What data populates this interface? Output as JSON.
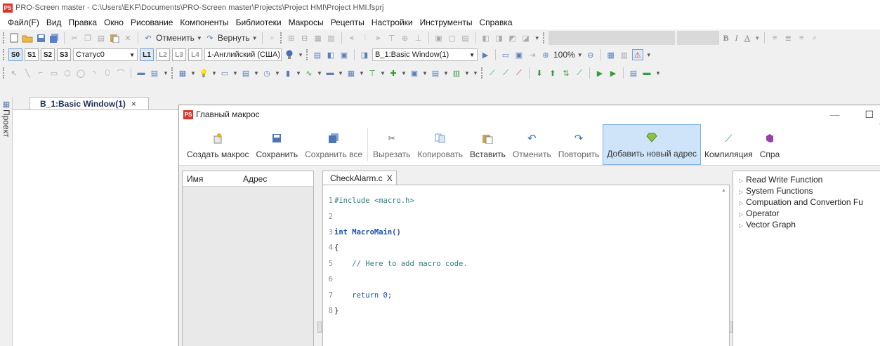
{
  "app": {
    "title": "PRO-Screen master - C:\\Users\\EKF\\Documents\\PRO-Screen master\\Projects\\Project HMI\\Project HMI.fsprj",
    "logo_text": "PS"
  },
  "menu": [
    "Файл(F)",
    "Вид",
    "Правка",
    "Окно",
    "Рисование",
    "Компоненты",
    "Библиотеки",
    "Макросы",
    "Рецепты",
    "Настройки",
    "Инструменты",
    "Справка"
  ],
  "toolbar1": {
    "undo_label": "Отменить",
    "redo_label": "Вернуть",
    "format_bold": "B",
    "format_italic": "I",
    "format_underline": "A"
  },
  "toolbar2": {
    "state_buttons": [
      "S0",
      "S1",
      "S2",
      "S3"
    ],
    "status_combo": "Статус0",
    "language_combo": "1-Английский (США)",
    "window_combo": "B_1:Basic Window(1)",
    "zoom": "100%"
  },
  "side_panel": {
    "label": "Проект"
  },
  "doc_tab": {
    "label": "B_1:Basic Window(1)",
    "close": "×"
  },
  "dialog": {
    "title": "Главный макрос",
    "logo_text": "PS",
    "win_minimize": "—",
    "win_maximize": "☐",
    "ribbon": [
      {
        "label": "Создать макрос",
        "icon": "new-macro-icon"
      },
      {
        "label": "Сохранить",
        "icon": "save-icon"
      },
      {
        "label": "Сохранить все",
        "icon": "save-all-icon"
      },
      {
        "label": "Вырезать",
        "icon": "cut-icon"
      },
      {
        "label": "Копировать",
        "icon": "copy-icon"
      },
      {
        "label": "Вставить",
        "icon": "paste-icon"
      },
      {
        "label": "Отменить",
        "icon": "undo-icon"
      },
      {
        "label": "Повторить",
        "icon": "redo-icon"
      },
      {
        "label": "Добавить новый адрес",
        "icon": "add-address-icon"
      },
      {
        "label": "Компиляция",
        "icon": "compile-icon"
      },
      {
        "label": "Спра",
        "icon": "help-icon"
      }
    ],
    "var_table": {
      "col_name": "Имя",
      "col_address": "Адрес"
    },
    "editor": {
      "tab_label": "CheckAlarm.c",
      "tab_close": "X",
      "lines": [
        {
          "n": "1",
          "text": "#include <macro.h>"
        },
        {
          "n": "2",
          "text": ""
        },
        {
          "n": "3",
          "text": "int MacroMain()"
        },
        {
          "n": "4",
          "text": "{"
        },
        {
          "n": "5",
          "text": "    // Here to add macro code."
        },
        {
          "n": "6",
          "text": ""
        },
        {
          "n": "7",
          "text": "    return 0;"
        },
        {
          "n": "8",
          "text": "}"
        }
      ]
    },
    "functions": [
      "Read Write Function",
      "System Functions",
      "Compuation and Convertion Fu",
      "Operator",
      "Vector Graph"
    ]
  },
  "colors": {
    "active_ribbon": "#cfe4f8",
    "keyword": "#1c4fb0",
    "comment": "#2f7f84",
    "logo": "#d9362b"
  }
}
